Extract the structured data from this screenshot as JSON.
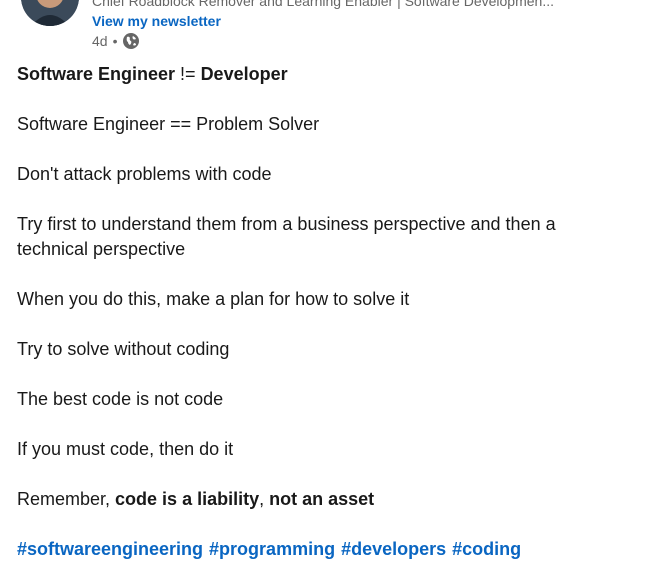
{
  "author": {
    "headline": "Chief Roadblock Remover and Learning Enabler | Software Developmen...",
    "newsletter_label": "View my newsletter",
    "time_ago": "4d",
    "separator": "•",
    "visibility_icon": "globe-icon"
  },
  "post": {
    "line1": {
      "part1": "Software Engineer",
      "part2": " != ",
      "part3": "Developer"
    },
    "line2": "Software Engineer == Problem Solver",
    "line3": "Don't attack problems with code",
    "line4": "Try first to understand them from a business perspective and then a technical perspective",
    "line5": "When you do this, make a plan for how to solve it",
    "line6": "Try to solve without coding",
    "line7": "The best code is not code",
    "line8": "If you must code, then do it",
    "line9": {
      "part1": "Remember, ",
      "part2": "code is a liability",
      "part3": ", ",
      "part4": "not an asset"
    },
    "hashtags": [
      "#softwareengineering",
      "#programming",
      "#developers",
      "#coding"
    ]
  },
  "colors": {
    "link": "#0a66c2",
    "text": "#191919",
    "muted": "#666666"
  }
}
